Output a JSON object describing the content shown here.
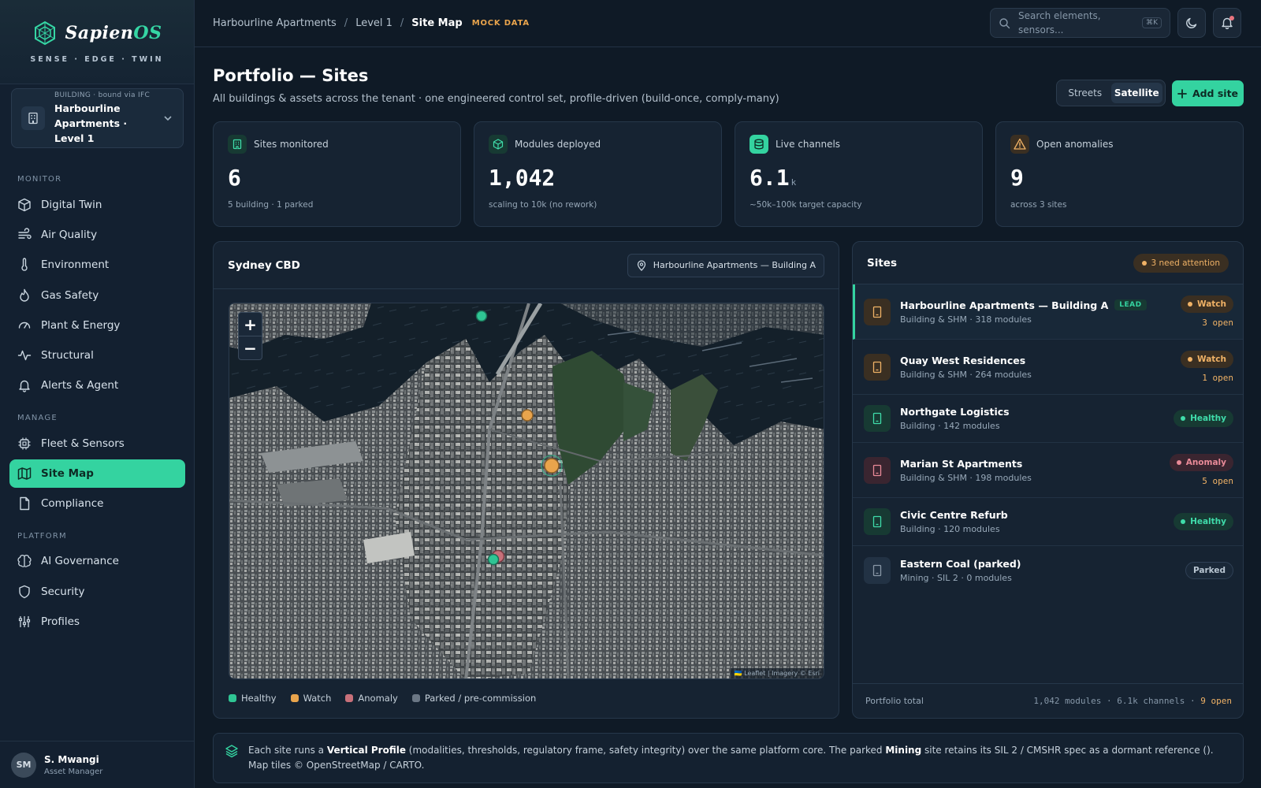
{
  "brand": {
    "name_main": "Sapien",
    "name_accent": "OS",
    "tagline": "SENSE · EDGE · TWIN"
  },
  "site_selector": {
    "context": "BUILDING · bound via IFC",
    "name": "Harbourline Apartments · Level 1"
  },
  "nav": {
    "monitor_label": "MONITOR",
    "manage_label": "MANAGE",
    "platform_label": "PLATFORM",
    "items": [
      {
        "label": "Digital Twin",
        "icon": "cube-icon"
      },
      {
        "label": "Air Quality",
        "icon": "wind-icon"
      },
      {
        "label": "Environment",
        "icon": "thermometer-icon"
      },
      {
        "label": "Gas Safety",
        "icon": "flame-icon"
      },
      {
        "label": "Plant & Energy",
        "icon": "gauge-icon"
      },
      {
        "label": "Structural",
        "icon": "activity-icon"
      },
      {
        "label": "Alerts & Agent",
        "icon": "bell-icon"
      },
      {
        "label": "Fleet & Sensors",
        "icon": "chip-icon"
      },
      {
        "label": "Site Map",
        "icon": "map-icon"
      },
      {
        "label": "Compliance",
        "icon": "document-icon"
      },
      {
        "label": "AI Governance",
        "icon": "brain-icon"
      },
      {
        "label": "Security",
        "icon": "shield-icon"
      },
      {
        "label": "Profiles",
        "icon": "sliders-icon"
      }
    ]
  },
  "user": {
    "initials": "SM",
    "name": "S. Mwangi",
    "role": "Asset Manager"
  },
  "breadcrumb": {
    "root": "Harbourline Apartments",
    "level": "Level 1",
    "current": "Site Map",
    "tag": "MOCK DATA"
  },
  "search": {
    "placeholder": "Search elements, sensors...",
    "shortcut": "⌘K"
  },
  "page": {
    "title": "Portfolio — Sites",
    "subtitle": "All buildings & assets across the tenant · one engineered control set, profile-driven (build-once, comply-many)"
  },
  "view_toggle": {
    "streets": "Streets",
    "satellite": "Satellite",
    "selected": "Satellite"
  },
  "add_site_label": "Add site",
  "kpis": [
    {
      "label": "Sites monitored",
      "value": "6",
      "unit": "",
      "foot": "5 building · 1 parked",
      "icon": "building-icon"
    },
    {
      "label": "Modules deployed",
      "value": "1,042",
      "unit": "",
      "foot": "scaling to 10k (no rework)",
      "icon": "box-icon"
    },
    {
      "label": "Live channels",
      "value": "6.1",
      "unit": "k",
      "foot": "~50k–100k target capacity",
      "icon": "database-icon"
    },
    {
      "label": "Open anomalies",
      "value": "9",
      "unit": "",
      "foot": "across 3 sites",
      "icon": "warning-icon"
    }
  ],
  "map": {
    "region": "Sydney CBD",
    "focus": "Harbourline Apartments — Building A",
    "zoom_in": "+",
    "zoom_out": "−",
    "attribution": "🇺🇦 Leaflet | Imagery © Esri",
    "legend": [
      {
        "label": "Healthy",
        "color": "#2fc594"
      },
      {
        "label": "Watch",
        "color": "#e9a44c"
      },
      {
        "label": "Anomaly",
        "color": "#c8707a"
      },
      {
        "label": "Parked / pre-commission",
        "color": "#6b7785"
      }
    ]
  },
  "sites": {
    "title": "Sites",
    "attention": "3 need attention",
    "rows": [
      {
        "name": "Harbourline Apartments — Building A",
        "tag": "LEAD",
        "sub": "Building & SHM · 318 modules",
        "status": "Watch",
        "open": "3 open"
      },
      {
        "name": "Quay West Residences",
        "tag": "",
        "sub": "Building & SHM · 264 modules",
        "status": "Watch",
        "open": "1 open"
      },
      {
        "name": "Northgate Logistics",
        "tag": "",
        "sub": "Building · 142 modules",
        "status": "Healthy",
        "open": ""
      },
      {
        "name": "Marian St Apartments",
        "tag": "",
        "sub": "Building & SHM · 198 modules",
        "status": "Anomaly",
        "open": "5 open"
      },
      {
        "name": "Civic Centre Refurb",
        "tag": "",
        "sub": "Building · 120 modules",
        "status": "Healthy",
        "open": ""
      },
      {
        "name": "Eastern Coal (parked)",
        "tag": "",
        "sub": "Mining · SIL 2 · 0 modules",
        "status": "Parked",
        "open": ""
      }
    ],
    "footer_label": "Portfolio total",
    "footer_stats": "1,042 modules · 6.1k channels · ",
    "footer_open": "9 open"
  },
  "note": {
    "p1": "Each site runs a ",
    "b1": "Vertical Profile",
    "p2": " (modalities, thresholds, regulatory frame, safety integrity) over the same platform core. The parked ",
    "b2": "Mining",
    "p3": " site retains its SIL 2 / CMSHR spec as a dormant reference (). Map tiles © OpenStreetMap / CARTO."
  },
  "colors": {
    "accent": "#34d3a0",
    "watch": "#e9a44c",
    "anomaly": "#c8707a",
    "parked": "#6b7785",
    "background": "#0f1a26"
  }
}
